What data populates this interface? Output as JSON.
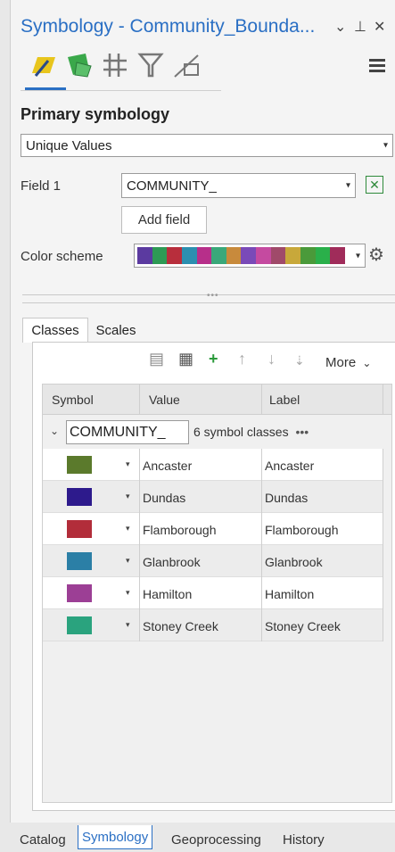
{
  "pane": {
    "title": "Symbology - Community_Bounda...",
    "heading": "Primary symbology",
    "renderer": "Unique Values",
    "field1_label": "Field 1",
    "field1_value": "COMMUNITY_",
    "add_field": "Add field",
    "color_scheme_label": "Color scheme",
    "color_scheme": [
      "#5b3aa0",
      "#2e9a55",
      "#b82e3c",
      "#2c8fb0",
      "#b72f8a",
      "#3aa87a",
      "#c88a3c",
      "#7a4ab8",
      "#c54aa0",
      "#a04a6a",
      "#c8a83a",
      "#4a9a3a",
      "#2ab04a",
      "#a02c5a"
    ]
  },
  "tabs": {
    "classes": "Classes",
    "scales": "Scales"
  },
  "classes_toolbar": {
    "more": "More"
  },
  "grid": {
    "headers": {
      "symbol": "Symbol",
      "value": "Value",
      "label": "Label"
    },
    "group_field": "COMMUNITY_",
    "group_count": "6 symbol classes",
    "group_more": "•••",
    "rows": [
      {
        "value": "Ancaster",
        "label": "Ancaster",
        "color": "#5b7a2c"
      },
      {
        "value": "Dundas",
        "label": "Dundas",
        "color": "#2d1a8c"
      },
      {
        "value": "Flamborough",
        "label": "Flamborough",
        "color": "#b22d3a"
      },
      {
        "value": "Glanbrook",
        "label": "Glanbrook",
        "color": "#2b7fa6"
      },
      {
        "value": "Hamilton",
        "label": "Hamilton",
        "color": "#9c3f95"
      },
      {
        "value": "Stoney Creek",
        "label": "Stoney Creek",
        "color": "#2aa37e"
      }
    ]
  },
  "bottom_tabs": [
    "Catalog",
    "Symbology",
    "Geoprocessing",
    "History"
  ],
  "active_bottom_tab": "Symbology"
}
